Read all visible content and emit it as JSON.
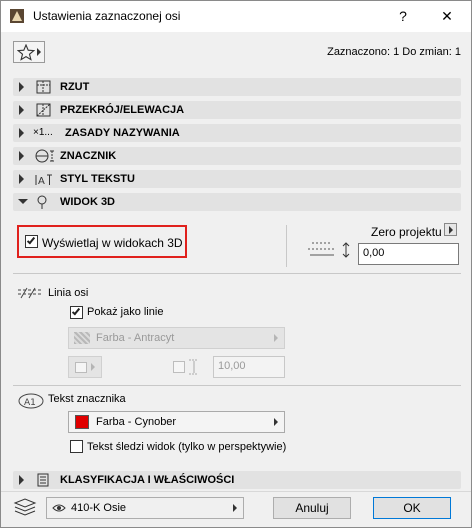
{
  "window": {
    "title": "Ustawienia zaznaczonej osi",
    "help_label": "?",
    "close_label": "✕"
  },
  "header": {
    "status": "Zaznaczono: 1 Do zmian: 1"
  },
  "sections": {
    "rzut": "RZUT",
    "przekroj": "PRZEKRÓJ/ELEWACJA",
    "zasady": "ZASADY NAZYWANIA",
    "znacznik": "ZNACZNIK",
    "styl": "STYL TEKSTU",
    "widok": "WIDOK 3D",
    "klasyfikacja": "KLASYFIKACJA I WŁAŚCIWOŚCI",
    "zasady_icon_text": "×1..."
  },
  "widok3d": {
    "show_in_3d_label": "Wyświetlaj w widokach 3D",
    "show_in_3d_checked": true,
    "zero_label": "Zero projektu",
    "zero_value": "0,00"
  },
  "linia_osi": {
    "title": "Linia osi",
    "show_as_lines_label": "Pokaż jako linie",
    "show_as_lines_checked": true,
    "pen_label": "Farba - Antracyt",
    "value": "10,00"
  },
  "tekst_znacznika": {
    "title": "Tekst znacznika",
    "pen_label": "Farba - Cynober",
    "pen_color": "#e00000",
    "follow_label": "Tekst śledzi widok (tylko w perspektywie)",
    "follow_checked": false
  },
  "footer": {
    "layer_label": "410-K Osie",
    "cancel_label": "Anuluj",
    "ok_label": "OK"
  }
}
